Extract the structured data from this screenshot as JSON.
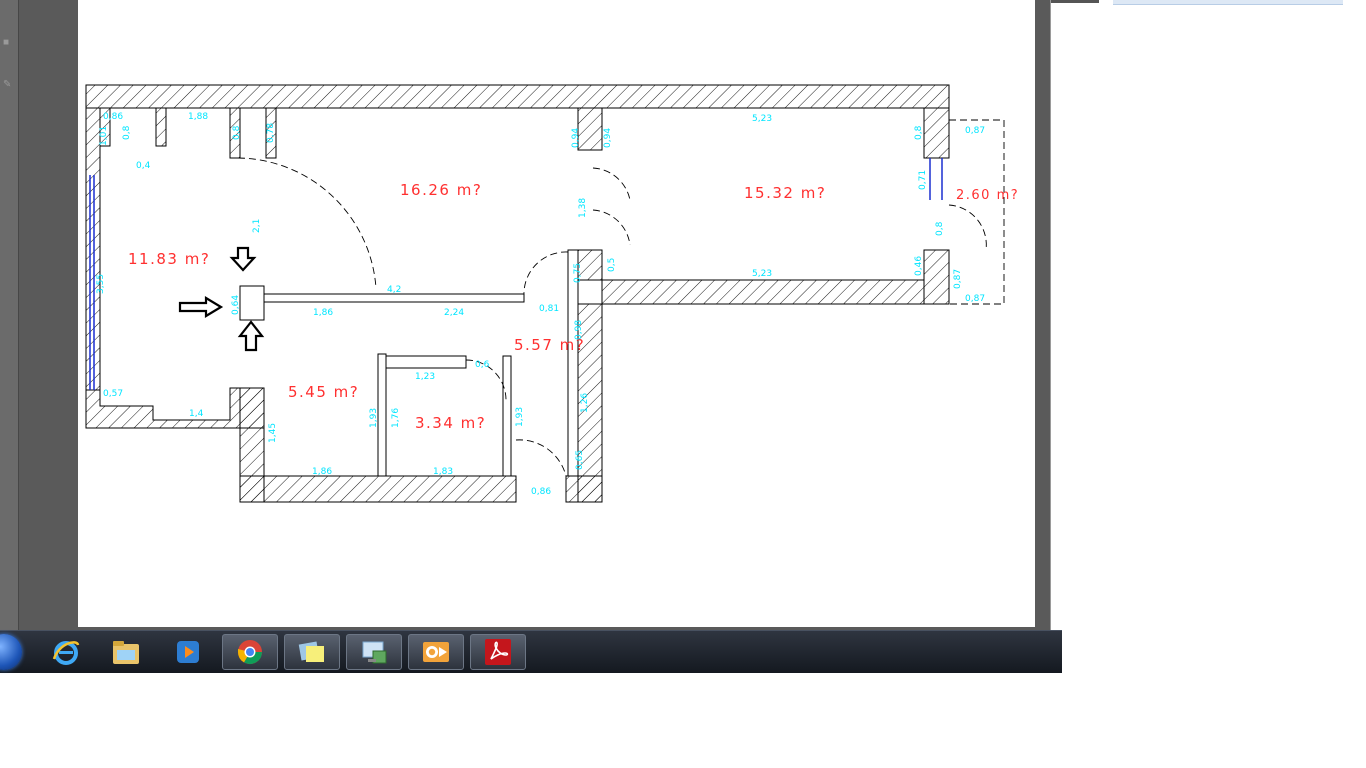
{
  "plan": {
    "areas": [
      {
        "id": "room-a",
        "text": "11.83  m?"
      },
      {
        "id": "room-b",
        "text": "16.26  m?"
      },
      {
        "id": "room-c",
        "text": "15.32  m?"
      },
      {
        "id": "balcony",
        "text": "2.60  m?"
      },
      {
        "id": "hall",
        "text": "5.57  m?"
      },
      {
        "id": "room-d",
        "text": "5.45  m?"
      },
      {
        "id": "room-e",
        "text": "3.34  m?"
      }
    ],
    "dimensions": {
      "d01": "0,86",
      "d02": "1,01",
      "d03": "0,8",
      "d04": "0,4",
      "d05": "1,88",
      "d06": "0,8",
      "d07": "0,78",
      "d08": "0,94",
      "d09": "0,94",
      "d10": "5,23",
      "d11": "0,8",
      "d12": "0,87",
      "d13": "2,1",
      "d14": "1,38",
      "d15": "0,71",
      "d16": "3,55",
      "d17": "0,8",
      "d18": "0,75",
      "d19": "0,5",
      "d20": "5,23",
      "d21": "0,46",
      "d22": "0,87",
      "d23": "0,87",
      "d24": "4,2",
      "d25": "0,64",
      "d26": "1,86",
      "d27": "2,24",
      "d28": "0,81",
      "d29": "0,98",
      "d30": "0,6",
      "d31": "1,23",
      "d32": "0,57",
      "d33": "1,4",
      "d34": "1,93",
      "d35": "1,76",
      "d36": "1,93",
      "d37": "1,26",
      "d38": "1,45",
      "d39": "0,65",
      "d40": "1,86",
      "d41": "1,83",
      "d42": "0,86"
    }
  },
  "taskbar": {
    "items": [
      {
        "name": "internet-explorer-icon"
      },
      {
        "name": "file-explorer-icon"
      },
      {
        "name": "media-player-icon"
      },
      {
        "name": "chrome-icon"
      },
      {
        "name": "sticky-notes-icon"
      },
      {
        "name": "remote-desktop-icon"
      },
      {
        "name": "outlook-icon"
      },
      {
        "name": "acrobat-reader-icon"
      }
    ]
  }
}
